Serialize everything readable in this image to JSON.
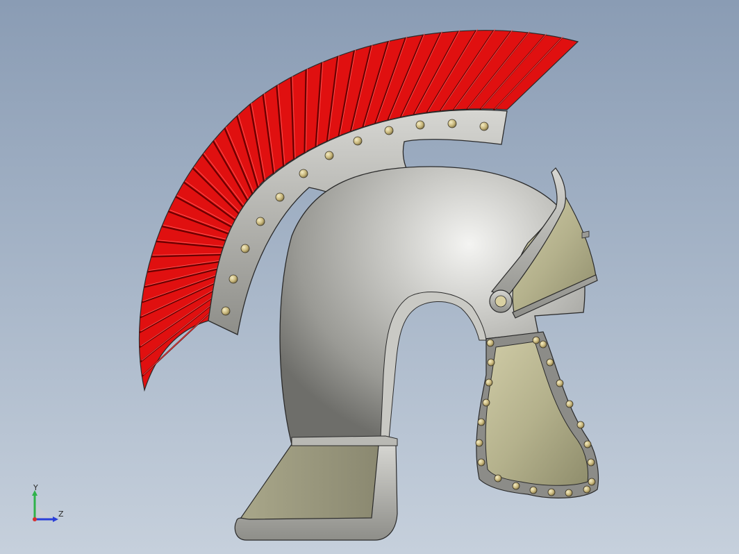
{
  "viewport": {
    "background_top": "#8a9cb4",
    "background_bottom": "#c6d0dc"
  },
  "model": {
    "colors": {
      "crest_red": "#e01010",
      "crest_groove": "#7a0000",
      "steel_light": "#e6e6e4",
      "steel_mid": "#b7b7b2",
      "steel_dark": "#6d6d68",
      "brass": "#b6b48e",
      "brass_dark": "#7f7d5e",
      "rivet": "#d2c28a",
      "outline": "#2a2a2a"
    }
  },
  "triad": {
    "y_label": "Y",
    "z_label": "Z",
    "y_color": "#2fb24a",
    "z_color": "#2a3fd8",
    "x_color": "#d83030"
  }
}
